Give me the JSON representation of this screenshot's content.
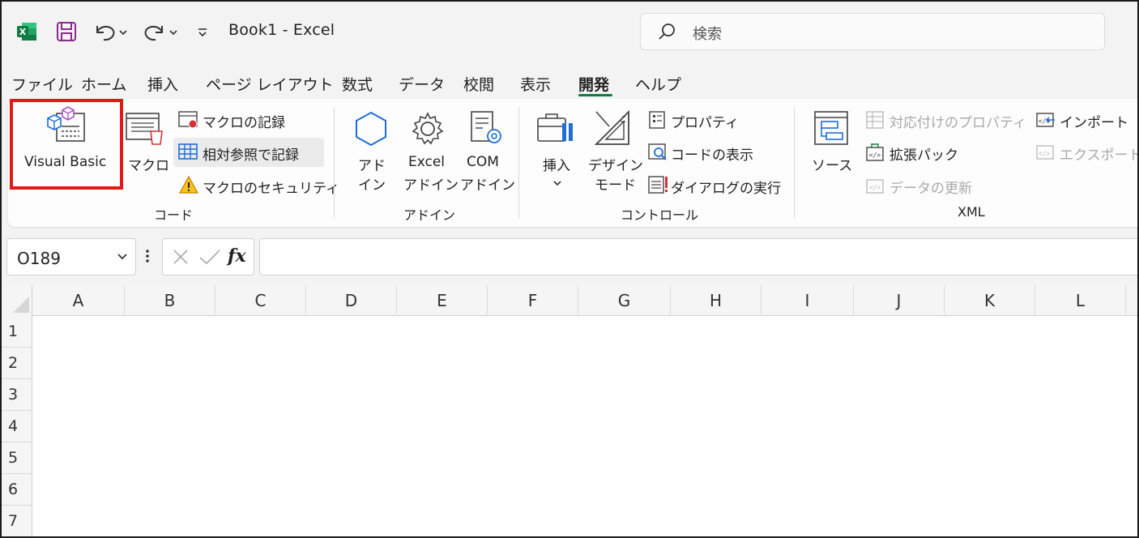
{
  "window": {
    "title": "Book1  -  Excel"
  },
  "search": {
    "placeholder": "検索"
  },
  "tabs": [
    {
      "label": "ファイル"
    },
    {
      "label": "ホーム"
    },
    {
      "label": "挿入"
    },
    {
      "label": "ページ レイアウト"
    },
    {
      "label": "数式"
    },
    {
      "label": "データ"
    },
    {
      "label": "校閲"
    },
    {
      "label": "表示"
    },
    {
      "label": "開発",
      "active": true
    },
    {
      "label": "ヘルプ"
    }
  ],
  "ribbon": {
    "code": {
      "group_label": "コード",
      "visual_basic": "Visual Basic",
      "macro": "マクロ",
      "record_macro": "マクロの記録",
      "relative_ref": "相対参照で記録",
      "macro_security": "マクロのセキュリティ"
    },
    "addins": {
      "group_label": "アドイン",
      "addin_line1": "アド",
      "addin_line2": "イン",
      "excel_line1": "Excel",
      "excel_line2": "アドイン",
      "com_line1": "COM",
      "com_line2": "アドイン"
    },
    "controls": {
      "group_label": "コントロール",
      "insert": "挿入",
      "design_line1": "デザイン",
      "design_line2": "モード",
      "properties": "プロパティ",
      "view_code": "コードの表示",
      "run_dialog": "ダイアログの実行"
    },
    "xml": {
      "group_label": "XML",
      "source": "ソース",
      "map_properties": "対応付けのプロパティ",
      "expansion_packs": "拡張パック",
      "refresh_data": "データの更新",
      "import": "インポート",
      "export": "エクスポート"
    }
  },
  "formula_bar": {
    "name_box": "O189",
    "fx": "fx",
    "formula": ""
  },
  "grid": {
    "columns": [
      "A",
      "B",
      "C",
      "D",
      "E",
      "F",
      "G",
      "H",
      "I",
      "J",
      "K",
      "L"
    ],
    "rows": [
      "1",
      "2",
      "3",
      "4",
      "5",
      "6",
      "7"
    ]
  },
  "colors": {
    "accent": "#107c41",
    "highlight": "#e11919"
  }
}
